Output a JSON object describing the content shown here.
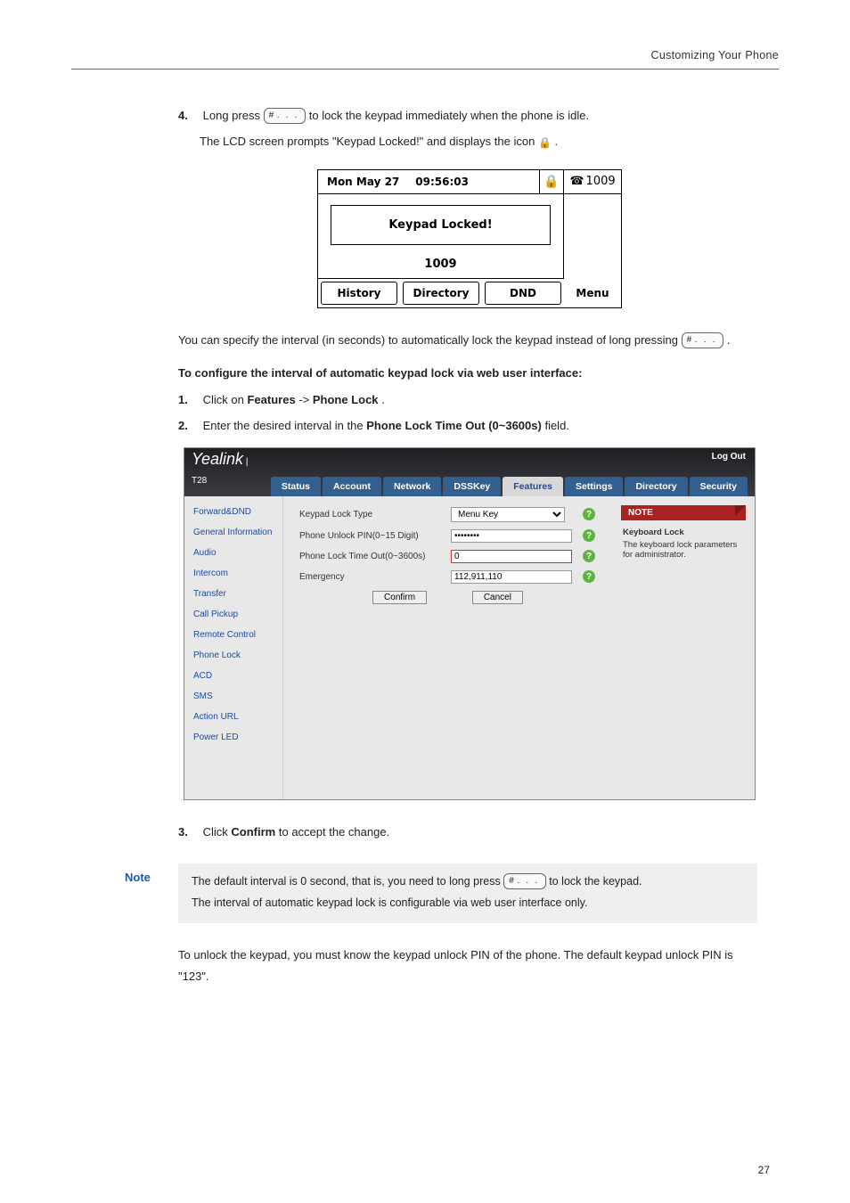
{
  "header": {
    "title": "Customizing Your Phone"
  },
  "step4": {
    "num": "4.",
    "pre": "Long press ",
    "key": "#﹒﹒﹒",
    "post": " to lock the keypad immediately when the phone is idle.",
    "line2_pre": "The LCD screen prompts \"Keypad Locked!\" and displays the icon ",
    "line2_icon": "🔒",
    "line2_post": " ."
  },
  "lcd": {
    "date": "Mon May 27",
    "time": "09:56:03",
    "lock": "🔒",
    "phone_glyph": "☎",
    "ext": "1009",
    "msg": "Keypad Locked!",
    "num": "1009",
    "sk1": "History",
    "sk2": "Directory",
    "sk3": "DND",
    "sk4": "Menu"
  },
  "after_lcd": {
    "p1_pre": "You can specify the interval (in seconds) to automatically lock the keypad instead of long pressing ",
    "p1_key": "#﹒﹒﹒",
    "p1_post": " ."
  },
  "heading_web": "To configure the interval of automatic keypad lock via web user interface:",
  "web_steps": {
    "s1_num": "1.",
    "s1_a": "Click on ",
    "s1_b": "Features",
    "s1_c": "->",
    "s1_d": "Phone Lock",
    "s1_e": ".",
    "s2_num": "2.",
    "s2_a": "Enter the desired interval in the ",
    "s2_b": "Phone Lock Time Out (0~3600s)",
    "s2_c": " field."
  },
  "webui": {
    "brand": "Yealink",
    "brand_sub": " | T28",
    "logout": "Log Out",
    "tabs": [
      "Status",
      "Account",
      "Network",
      "DSSKey",
      "Features",
      "Settings",
      "Directory",
      "Security"
    ],
    "active_tab_index": 4,
    "nav": [
      "Forward&DND",
      "General Information",
      "Audio",
      "Intercom",
      "Transfer",
      "Call Pickup",
      "Remote Control",
      "Phone Lock",
      "ACD",
      "SMS",
      "Action URL",
      "Power LED"
    ],
    "rows": {
      "r0_label": "Keypad Lock Type",
      "r0_value": "Menu Key",
      "r1_label": "Phone Unlock PIN(0~15 Digit)",
      "r1_value": "••••••••",
      "r2_label": "Phone Lock Time Out(0~3600s)",
      "r2_value": "0",
      "r3_label": "Emergency",
      "r3_value": "112,911,110"
    },
    "confirm": "Confirm",
    "cancel": "Cancel",
    "note_head": "NOTE",
    "note_title": "Keyboard Lock",
    "note_body": "The keyboard lock parameters for administrator."
  },
  "step3": {
    "num": "3.",
    "a": "Click ",
    "b": "Confirm",
    "c": " to accept the change."
  },
  "note_block": {
    "label": "Note",
    "l1_a": "The default interval is 0 second, that is, you need to long press ",
    "l1_key": "#﹒﹒﹒",
    "l1_b": " to lock the keypad.",
    "l2": "The interval of automatic keypad lock is configurable via web user interface only."
  },
  "tail": {
    "p": "To unlock the keypad, you must know the keypad unlock PIN of the phone. The default keypad unlock PIN is \"123\"."
  },
  "page_number": "27"
}
